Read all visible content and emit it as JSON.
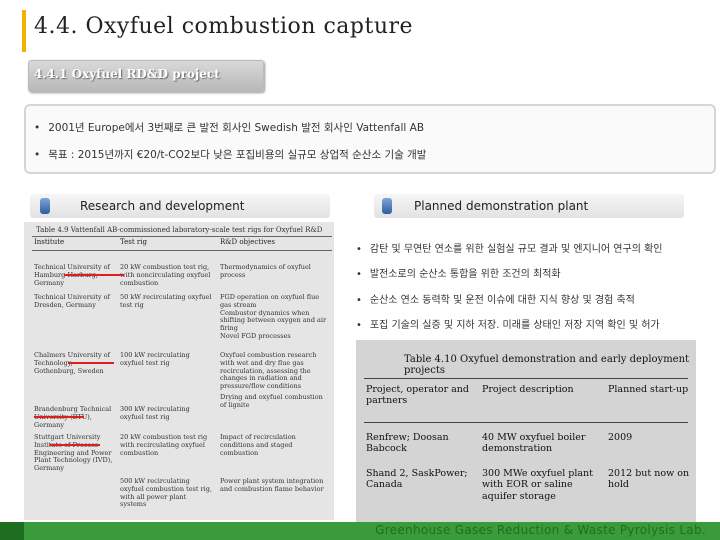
{
  "slide": {
    "title": "4.4. Oxyfuel combustion capture",
    "subtitle": "4.4.1 Oxyfuel RD&D project",
    "bullets": [
      "2001년 Europe에서 3번째로 큰 발전 회사인 Swedish 발전 회사인 Vattenfall AB",
      "목표 : 2015년까지 €20/t-CO2보다 낮은 포집비용의 실규모 상업적 순산소 기술 개발"
    ],
    "bullet_symbol": "•",
    "left_section": "Research and development",
    "right_section": "Planned demonstration plant",
    "right_bullets": [
      "감탄 및 무연탄 연소를 위한 실험실 규모 결과 및 엔지니어 연구의 확인",
      "발전소로의 순산소 통합을 위한 조건의 최적화",
      "순산소 연소 동력학 및 운전 이슈에 대한 지식 향상 및 경험 축적",
      "포집 기술의 실증 및 지하 저장. 미래를 상태인 저장 지역 확인 및 허가"
    ],
    "footer": "Greenhouse Gases Reduction & Waste Pyrolysis Lab."
  },
  "table49": {
    "caption": "Table 4.9  Vattenfall AB-commissioned laboratory-scale test rigs for Oxyfuel R&D",
    "headers": [
      "Institute",
      "Test rig",
      "R&D objectives"
    ],
    "rows": [
      [
        "Technical University of Hamburg-Harburg, Germany",
        "20 kW combustion test rig, with noncirculating oxyfuel combustion",
        "Thermodynamics of oxyfuel process"
      ],
      [
        "Technical University of Dresden, Germany",
        "50 kW recirculating oxyfuel test rig",
        "FGD operation on oxyfuel flue gas stream\nCombustor dynamics when shifting between oxygen and air firing\nNovel FGD processes"
      ],
      [
        "Chalmers University of Technology, Gothenburg, Sweden",
        "100 kW recirculating oxyfuel test rig",
        "Oxyfuel combustion research with wet and dry flue gas recirculation, assessing the changes in radiation and pressure/flow conditions"
      ],
      [
        "Brandenburg Technical University (BTU), Germany",
        "300 kW recirculating oxyfuel test rig",
        "Drying and oxyfuel combustion of lignite"
      ],
      [
        "Stuttgart University Institute of Process Engineering and Power Plant Technology (IVD), Germany",
        "20 kW combustion test rig with recirculating oxyfuel combustion",
        "Impact of recirculation conditions and staged combustion"
      ],
      [
        "",
        "500 kW recirculating oxyfuel combustion test rig, with all power plant systems",
        "Power plant system integration and combustion flame behavior"
      ]
    ]
  },
  "table410": {
    "caption": "Table 4.10  Oxyfuel demonstration and early deployment projects",
    "headers": [
      "Project, operator and partners",
      "Project description",
      "Planned start-up"
    ],
    "rows": [
      [
        "Renfrew; Doosan Babcock",
        "40 MW oxyfuel boiler demonstration",
        "2009"
      ],
      [
        "Shand 2, SaskPower; Canada",
        "300 MWe oxyfuel plant with EOR or saline aquifer storage",
        "2012 but now on hold"
      ]
    ]
  },
  "colors": {
    "accent_bar": "#f0b400",
    "footer_green": "#3a9b3a",
    "footer_text": "#1f6e1f",
    "underline_red": "#e01e1e"
  }
}
